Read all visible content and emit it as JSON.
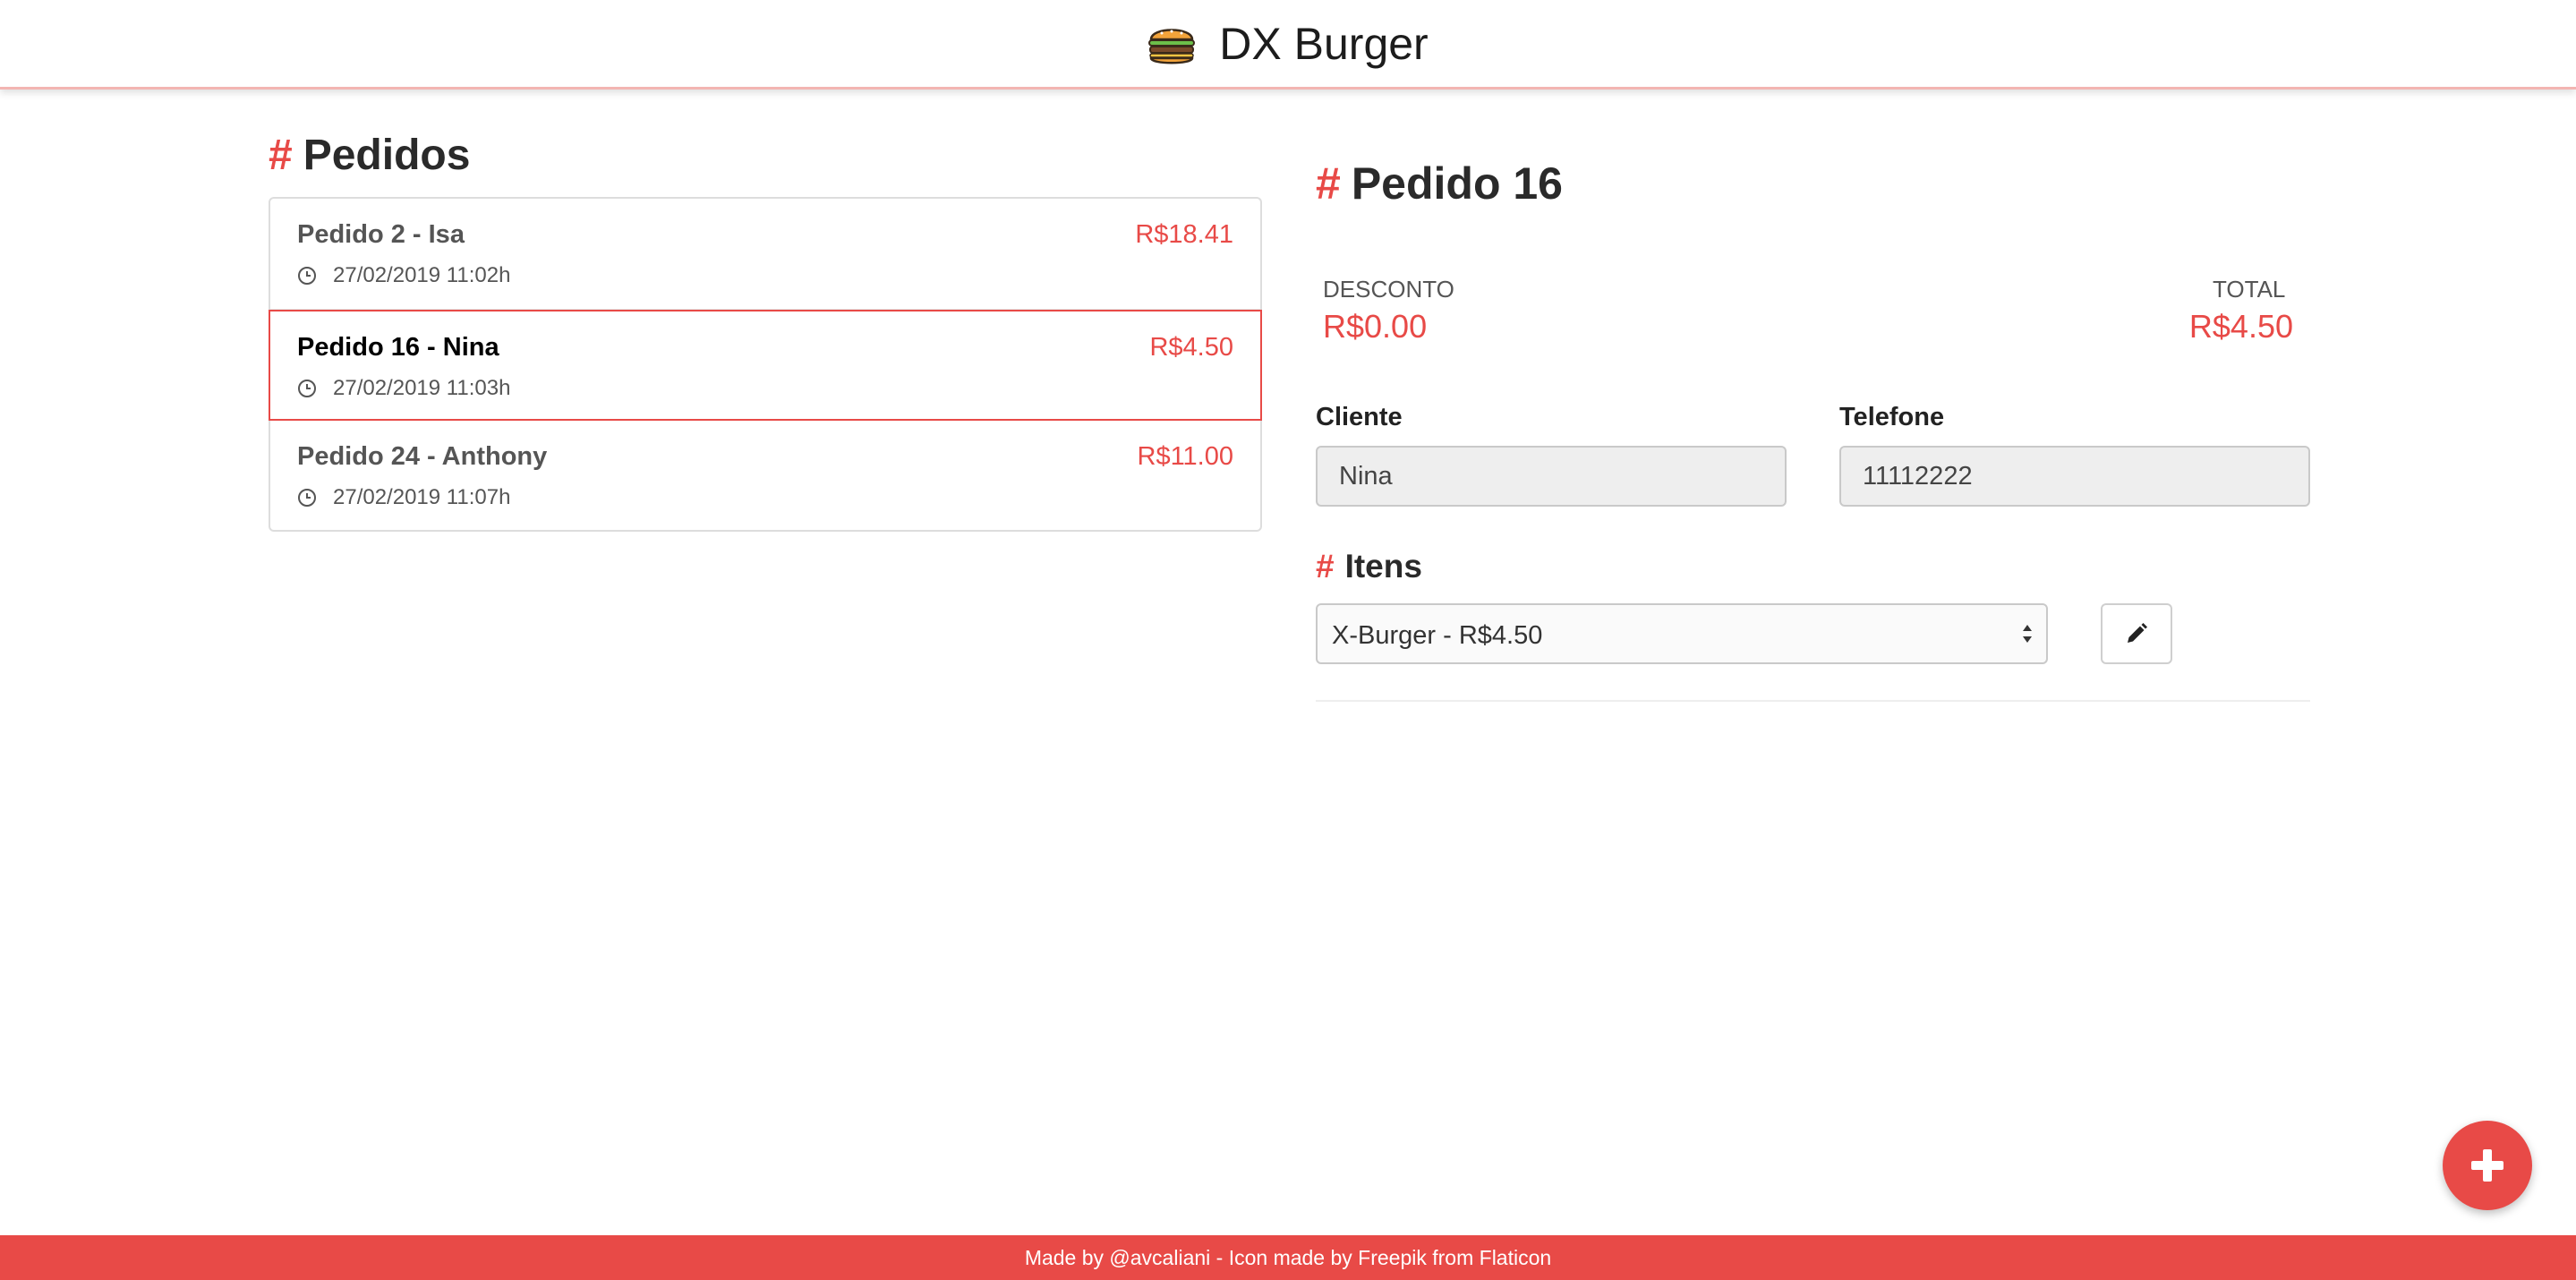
{
  "header": {
    "title": "DX Burger",
    "logo_icon": "burger-icon"
  },
  "orders": {
    "heading": "Pedidos",
    "items": [
      {
        "name": "Pedido 2 - Isa",
        "price": "R$18.41",
        "datetime": "27/02/2019 11:02h",
        "selected": false
      },
      {
        "name": "Pedido 16 - Nina",
        "price": "R$4.50",
        "datetime": "27/02/2019 11:03h",
        "selected": true
      },
      {
        "name": "Pedido 24 - Anthony",
        "price": "R$11.00",
        "datetime": "27/02/2019 11:07h",
        "selected": false
      }
    ]
  },
  "detail": {
    "heading": "Pedido 16",
    "discount_label": "DESCONTO",
    "discount_value": "R$0.00",
    "total_label": "TOTAL",
    "total_value": "R$4.50",
    "client_label": "Cliente",
    "client_value": "Nina",
    "phone_label": "Telefone",
    "phone_value": "11112222",
    "items_heading": "Itens",
    "item_selected": "X-Burger - R$4.50",
    "edit_icon": "pencil-icon"
  },
  "fab": {
    "icon": "plus-icon"
  },
  "footer": {
    "text": "Made by @avcaliani - Icon made by Freepik from Flaticon"
  },
  "colors": {
    "accent": "#e84a47",
    "header_border": "#f3b5b2",
    "input_bg": "#eeeeee"
  }
}
